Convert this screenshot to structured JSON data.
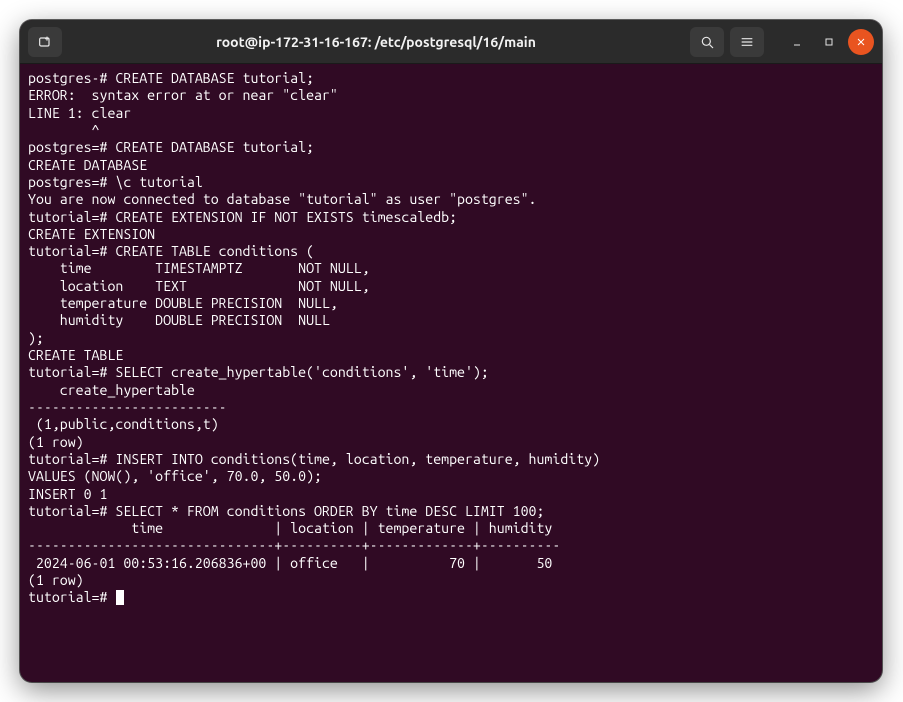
{
  "titlebar": {
    "title": "root@ip-172-31-16-167: /etc/postgresql/16/main",
    "new_tab_icon": "new-tab-icon",
    "search_icon": "search-icon",
    "menu_icon": "hamburger-icon",
    "min_icon": "minimize-icon",
    "max_icon": "maximize-icon",
    "close_icon": "close-icon"
  },
  "lines": [
    "postgres-# CREATE DATABASE tutorial;",
    "ERROR:  syntax error at or near \"clear\"",
    "LINE 1: clear",
    "        ^",
    "postgres=# CREATE DATABASE tutorial;",
    "CREATE DATABASE",
    "postgres=# \\c tutorial",
    "You are now connected to database \"tutorial\" as user \"postgres\".",
    "tutorial=# CREATE EXTENSION IF NOT EXISTS timescaledb;",
    "CREATE EXTENSION",
    "tutorial=# CREATE TABLE conditions (",
    "    time        TIMESTAMPTZ       NOT NULL,",
    "    location    TEXT              NOT NULL,",
    "    temperature DOUBLE PRECISION  NULL,",
    "    humidity    DOUBLE PRECISION  NULL",
    ");",
    "CREATE TABLE",
    "tutorial=# SELECT create_hypertable('conditions', 'time');",
    "    create_hypertable    ",
    "-------------------------",
    " (1,public,conditions,t)",
    "(1 row)",
    "",
    "tutorial=# INSERT INTO conditions(time, location, temperature, humidity)",
    "VALUES (NOW(), 'office', 70.0, 50.0);",
    "INSERT 0 1",
    "tutorial=# SELECT * FROM conditions ORDER BY time DESC LIMIT 100;",
    "             time              | location | temperature | humidity ",
    "-------------------------------+----------+-------------+----------",
    " 2024-06-01 00:53:16.206836+00 | office   |          70 |       50",
    "(1 row)",
    "",
    "tutorial=# "
  ],
  "prompt_cursor_line_index": 32
}
